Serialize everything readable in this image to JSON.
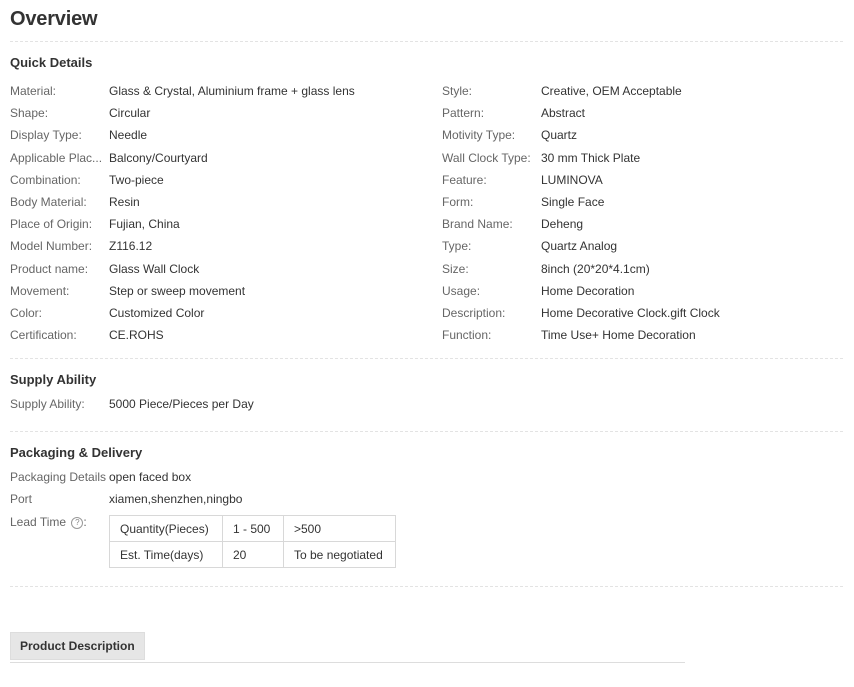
{
  "page": {
    "title": "Overview"
  },
  "quick_details": {
    "title": "Quick Details",
    "left": [
      {
        "label": "Material:",
        "value": "Glass & Crystal, Aluminium frame + glass lens"
      },
      {
        "label": "Shape:",
        "value": "Circular"
      },
      {
        "label": "Display Type:",
        "value": "Needle"
      },
      {
        "label": "Applicable Plac...",
        "value": "Balcony/Courtyard"
      },
      {
        "label": "Combination:",
        "value": "Two-piece"
      },
      {
        "label": "Body Material:",
        "value": "Resin"
      },
      {
        "label": "Place of Origin:",
        "value": "Fujian, China"
      },
      {
        "label": "Model Number:",
        "value": "Z116.12"
      },
      {
        "label": "Product name:",
        "value": "Glass Wall Clock"
      },
      {
        "label": "Movement:",
        "value": "Step or sweep movement"
      },
      {
        "label": "Color:",
        "value": "Customized Color"
      },
      {
        "label": "Certification:",
        "value": "CE.ROHS"
      }
    ],
    "right": [
      {
        "label": "Style:",
        "value": "Creative, OEM Acceptable"
      },
      {
        "label": "Pattern:",
        "value": "Abstract"
      },
      {
        "label": "Motivity Type:",
        "value": "Quartz"
      },
      {
        "label": "Wall Clock Type:",
        "value": "30 mm Thick Plate"
      },
      {
        "label": "Feature:",
        "value": "LUMINOVA"
      },
      {
        "label": "Form:",
        "value": "Single Face"
      },
      {
        "label": "Brand Name:",
        "value": "Deheng"
      },
      {
        "label": "Type:",
        "value": "Quartz Analog"
      },
      {
        "label": "Size:",
        "value": "8inch (20*20*4.1cm)"
      },
      {
        "label": "Usage:",
        "value": "Home Decoration"
      },
      {
        "label": "Description:",
        "value": "Home Decorative Clock.gift Clock"
      },
      {
        "label": "Function:",
        "value": "Time Use+ Home Decoration"
      }
    ]
  },
  "supply": {
    "title": "Supply Ability",
    "label": "Supply Ability:",
    "value": "5000 Piece/Pieces per Day"
  },
  "packaging": {
    "title": "Packaging & Delivery",
    "details_label": "Packaging Details",
    "details_value": "open faced box",
    "port_label": "Port",
    "port_value": "xiamen,shenzhen,ningbo",
    "lead_label": "Lead Time",
    "help_icon": "question-circle-icon",
    "help_glyph": "?",
    "lead_suffix": ":",
    "lead_table": {
      "rows": [
        [
          "Quantity(Pieces)",
          "1 - 500",
          ">500"
        ],
        [
          "Est. Time(days)",
          "20",
          "To be negotiated"
        ]
      ]
    }
  },
  "tabs": {
    "product_description": "Product Description"
  }
}
